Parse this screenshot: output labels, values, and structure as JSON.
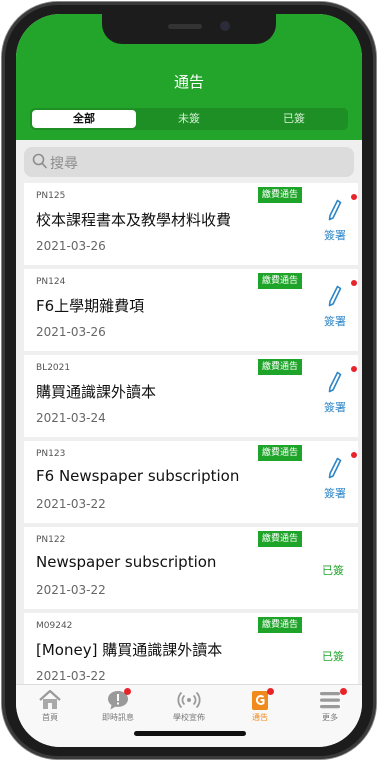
{
  "header": {
    "title": "通告"
  },
  "tabs": [
    {
      "label": "全部"
    },
    {
      "label": "未簽"
    },
    {
      "label": "已簽"
    }
  ],
  "search": {
    "placeholder": "搜尋"
  },
  "notices": [
    {
      "code": "PN125",
      "badge": "繳費通告",
      "title": "校本課程書本及教學材料收費",
      "date": "2021-03-26",
      "action": "簽署"
    },
    {
      "code": "PN124",
      "badge": "繳費通告",
      "title": "F6上學期雜費項",
      "date": "2021-03-26",
      "action": "簽署"
    },
    {
      "code": "BL2021",
      "badge": "繳費通告",
      "title": "購買通識課外讀本",
      "date": "2021-03-24",
      "action": "簽署"
    },
    {
      "code": "PN123",
      "badge": "繳費通告",
      "title": "F6 Newspaper subscription",
      "date": "2021-03-22",
      "action": "簽署"
    },
    {
      "code": "PN122",
      "badge": "繳費通告",
      "title": "Newspaper subscription",
      "date": "2021-03-22",
      "action": "已簽"
    },
    {
      "code": "M09242",
      "badge": "繳費通告",
      "title": "[Money] 購買通識課外讀本",
      "date": "2021-03-22",
      "action": "已簽"
    }
  ],
  "tabbar": [
    {
      "label": "首頁",
      "icon": "house-icon"
    },
    {
      "label": "即時訊息",
      "icon": "message-bubble-icon"
    },
    {
      "label": "學校宣佈",
      "icon": "broadcast-icon"
    },
    {
      "label": "通告",
      "icon": "notice-icon"
    },
    {
      "label": "更多",
      "icon": "menu-icon"
    }
  ],
  "colors": {
    "primary_green": "#22a52a",
    "sign_blue": "#2e86c8",
    "alert_red": "#e8242b",
    "active_orange": "#f08a1c"
  }
}
